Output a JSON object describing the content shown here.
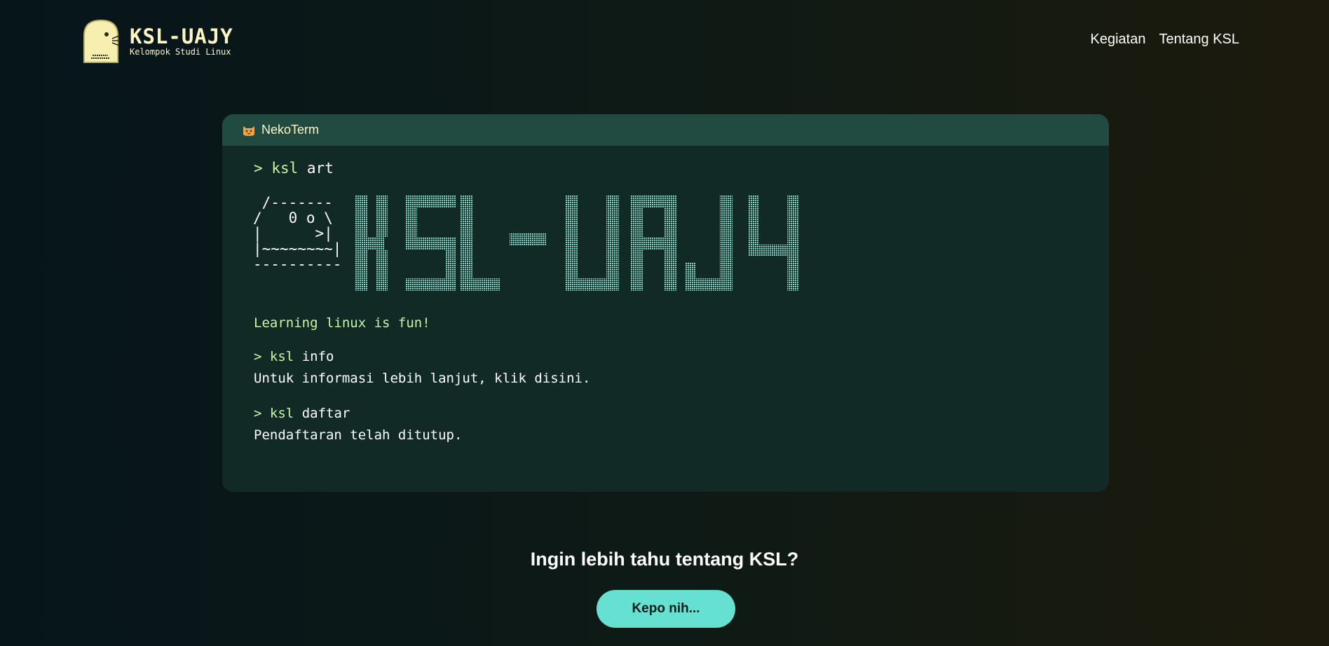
{
  "header": {
    "logo_title": "KSL-UAJY",
    "logo_subtitle": "Kelompok Studi Linux",
    "nav": [
      {
        "label": "Kegiatan"
      },
      {
        "label": "Tentang KSL"
      }
    ]
  },
  "terminal": {
    "title": "NekoTerm",
    "icon": "cat-face-icon",
    "commands": [
      {
        "prompt": ">",
        "keyword": "ksl",
        "arg": "art"
      },
      {
        "prompt": ">",
        "keyword": "ksl",
        "arg": "info"
      },
      {
        "prompt": ">",
        "keyword": "ksl",
        "arg": "daftar"
      }
    ],
    "ascii_cat": " /-------\n/   0 o \\\n|      >|\n|~~~~~~~~|\n----------",
    "art_logo": "KSL-UAJY",
    "tagline": "Learning linux is fun!",
    "info_text": "Untuk informasi lebih lanjut, klik disini.",
    "daftar_text": "Pendaftaran telah ditutup."
  },
  "cta": {
    "title": "Ingin lebih tahu tentang KSL?",
    "button_label": "Kepo nih..."
  },
  "colors": {
    "accent": "#66e0d0",
    "prompt_green": "#c8f5a6",
    "logo_cream": "#fdf5c4",
    "terminal_bg": "#112a25",
    "terminal_bar": "#214a40",
    "art_fill": "#7fd6c5"
  }
}
